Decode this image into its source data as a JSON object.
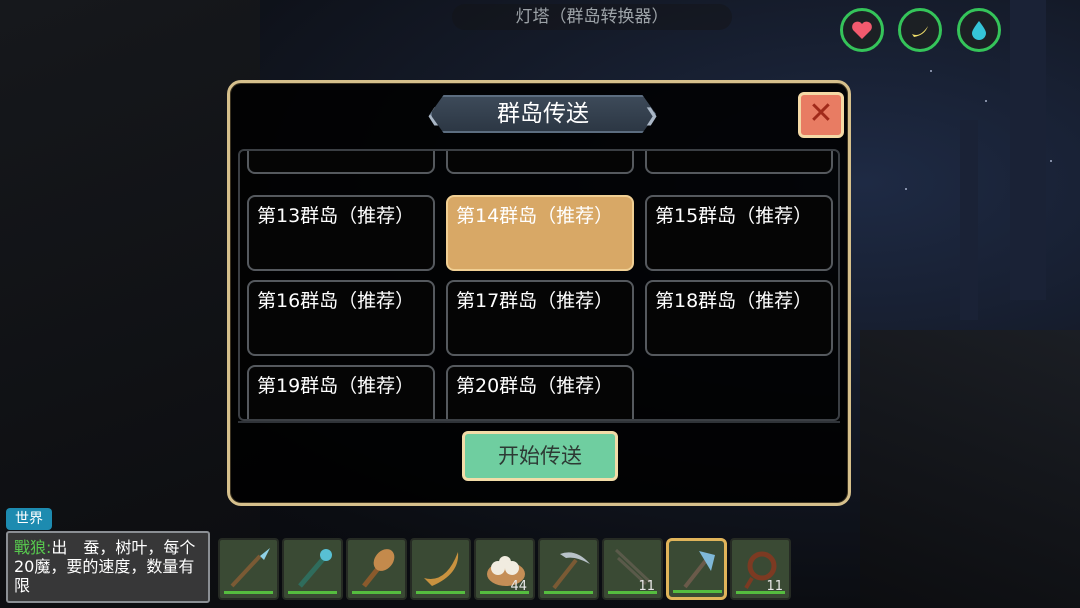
{
  "location_label": "灯塔（群岛转换器）",
  "stats": [
    {
      "name": "health",
      "icon": "heart-icon",
      "color": "#f25a6e"
    },
    {
      "name": "hunger",
      "icon": "banana-icon",
      "color": "#f2e06a"
    },
    {
      "name": "thirst",
      "icon": "water-drop-icon",
      "color": "#35c5d8"
    }
  ],
  "dialog": {
    "title": "群岛传送",
    "close_symbol": "✕",
    "islands": [
      {
        "label": "",
        "selected": false
      },
      {
        "label": "",
        "selected": false
      },
      {
        "label": "",
        "selected": false
      },
      {
        "label": "第13群岛（推荐）",
        "selected": false
      },
      {
        "label": "第14群岛（推荐）",
        "selected": true
      },
      {
        "label": "第15群岛（推荐）",
        "selected": false
      },
      {
        "label": "第16群岛（推荐）",
        "selected": false
      },
      {
        "label": "第17群岛（推荐）",
        "selected": false
      },
      {
        "label": "第18群岛（推荐）",
        "selected": false
      },
      {
        "label": "第19群岛（推荐）",
        "selected": false
      },
      {
        "label": "第20群岛（推荐）",
        "selected": false
      }
    ],
    "start_button": "开始传送"
  },
  "chat": {
    "channel": "世界",
    "sender": "戰狼",
    "separator": ":",
    "message": "出　蚕，树叶，每个20魔，要的速度，数量有限"
  },
  "hotbar": [
    {
      "item": "spear-icon",
      "count": ""
    },
    {
      "item": "staff-icon",
      "count": ""
    },
    {
      "item": "club-icon",
      "count": ""
    },
    {
      "item": "horn-icon",
      "count": ""
    },
    {
      "item": "dumplings-icon",
      "count": "44"
    },
    {
      "item": "pickaxe-icon",
      "count": ""
    },
    {
      "item": "arrow-icon",
      "count": "11"
    },
    {
      "item": "axe-icon",
      "count": "",
      "active": true
    },
    {
      "item": "rope-icon",
      "count": "11"
    }
  ]
}
